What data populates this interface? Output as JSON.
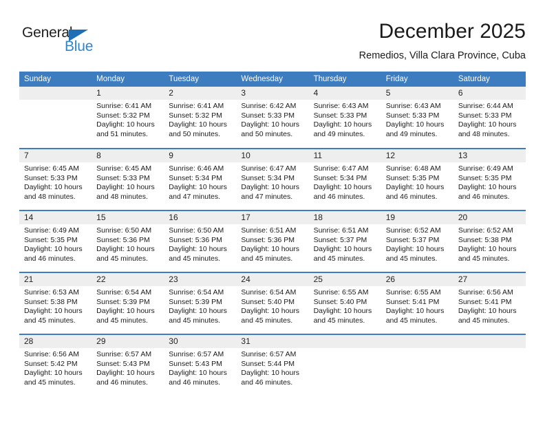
{
  "brand": {
    "name_part1": "General",
    "name_part2": "Blue",
    "triangle_color": "#1f6fb5",
    "blue_color": "#2f86cd"
  },
  "header": {
    "month_title": "December 2025",
    "location": "Remedios, Villa Clara Province, Cuba"
  },
  "theme": {
    "header_band": "#3d7cbf",
    "daynum_band": "#eeeeee",
    "divider": "#3d7cbf",
    "text": "#1a1a1a"
  },
  "weekdays": [
    "Sunday",
    "Monday",
    "Tuesday",
    "Wednesday",
    "Thursday",
    "Friday",
    "Saturday"
  ],
  "weeks": [
    [
      {
        "day": "",
        "sunrise": "",
        "sunset": "",
        "daylight": "",
        "daylight2": ""
      },
      {
        "day": "1",
        "sunrise": "Sunrise: 6:41 AM",
        "sunset": "Sunset: 5:32 PM",
        "daylight": "Daylight: 10 hours",
        "daylight2": "and 51 minutes."
      },
      {
        "day": "2",
        "sunrise": "Sunrise: 6:41 AM",
        "sunset": "Sunset: 5:32 PM",
        "daylight": "Daylight: 10 hours",
        "daylight2": "and 50 minutes."
      },
      {
        "day": "3",
        "sunrise": "Sunrise: 6:42 AM",
        "sunset": "Sunset: 5:33 PM",
        "daylight": "Daylight: 10 hours",
        "daylight2": "and 50 minutes."
      },
      {
        "day": "4",
        "sunrise": "Sunrise: 6:43 AM",
        "sunset": "Sunset: 5:33 PM",
        "daylight": "Daylight: 10 hours",
        "daylight2": "and 49 minutes."
      },
      {
        "day": "5",
        "sunrise": "Sunrise: 6:43 AM",
        "sunset": "Sunset: 5:33 PM",
        "daylight": "Daylight: 10 hours",
        "daylight2": "and 49 minutes."
      },
      {
        "day": "6",
        "sunrise": "Sunrise: 6:44 AM",
        "sunset": "Sunset: 5:33 PM",
        "daylight": "Daylight: 10 hours",
        "daylight2": "and 48 minutes."
      }
    ],
    [
      {
        "day": "7",
        "sunrise": "Sunrise: 6:45 AM",
        "sunset": "Sunset: 5:33 PM",
        "daylight": "Daylight: 10 hours",
        "daylight2": "and 48 minutes."
      },
      {
        "day": "8",
        "sunrise": "Sunrise: 6:45 AM",
        "sunset": "Sunset: 5:33 PM",
        "daylight": "Daylight: 10 hours",
        "daylight2": "and 48 minutes."
      },
      {
        "day": "9",
        "sunrise": "Sunrise: 6:46 AM",
        "sunset": "Sunset: 5:34 PM",
        "daylight": "Daylight: 10 hours",
        "daylight2": "and 47 minutes."
      },
      {
        "day": "10",
        "sunrise": "Sunrise: 6:47 AM",
        "sunset": "Sunset: 5:34 PM",
        "daylight": "Daylight: 10 hours",
        "daylight2": "and 47 minutes."
      },
      {
        "day": "11",
        "sunrise": "Sunrise: 6:47 AM",
        "sunset": "Sunset: 5:34 PM",
        "daylight": "Daylight: 10 hours",
        "daylight2": "and 46 minutes."
      },
      {
        "day": "12",
        "sunrise": "Sunrise: 6:48 AM",
        "sunset": "Sunset: 5:35 PM",
        "daylight": "Daylight: 10 hours",
        "daylight2": "and 46 minutes."
      },
      {
        "day": "13",
        "sunrise": "Sunrise: 6:49 AM",
        "sunset": "Sunset: 5:35 PM",
        "daylight": "Daylight: 10 hours",
        "daylight2": "and 46 minutes."
      }
    ],
    [
      {
        "day": "14",
        "sunrise": "Sunrise: 6:49 AM",
        "sunset": "Sunset: 5:35 PM",
        "daylight": "Daylight: 10 hours",
        "daylight2": "and 46 minutes."
      },
      {
        "day": "15",
        "sunrise": "Sunrise: 6:50 AM",
        "sunset": "Sunset: 5:36 PM",
        "daylight": "Daylight: 10 hours",
        "daylight2": "and 45 minutes."
      },
      {
        "day": "16",
        "sunrise": "Sunrise: 6:50 AM",
        "sunset": "Sunset: 5:36 PM",
        "daylight": "Daylight: 10 hours",
        "daylight2": "and 45 minutes."
      },
      {
        "day": "17",
        "sunrise": "Sunrise: 6:51 AM",
        "sunset": "Sunset: 5:36 PM",
        "daylight": "Daylight: 10 hours",
        "daylight2": "and 45 minutes."
      },
      {
        "day": "18",
        "sunrise": "Sunrise: 6:51 AM",
        "sunset": "Sunset: 5:37 PM",
        "daylight": "Daylight: 10 hours",
        "daylight2": "and 45 minutes."
      },
      {
        "day": "19",
        "sunrise": "Sunrise: 6:52 AM",
        "sunset": "Sunset: 5:37 PM",
        "daylight": "Daylight: 10 hours",
        "daylight2": "and 45 minutes."
      },
      {
        "day": "20",
        "sunrise": "Sunrise: 6:52 AM",
        "sunset": "Sunset: 5:38 PM",
        "daylight": "Daylight: 10 hours",
        "daylight2": "and 45 minutes."
      }
    ],
    [
      {
        "day": "21",
        "sunrise": "Sunrise: 6:53 AM",
        "sunset": "Sunset: 5:38 PM",
        "daylight": "Daylight: 10 hours",
        "daylight2": "and 45 minutes."
      },
      {
        "day": "22",
        "sunrise": "Sunrise: 6:54 AM",
        "sunset": "Sunset: 5:39 PM",
        "daylight": "Daylight: 10 hours",
        "daylight2": "and 45 minutes."
      },
      {
        "day": "23",
        "sunrise": "Sunrise: 6:54 AM",
        "sunset": "Sunset: 5:39 PM",
        "daylight": "Daylight: 10 hours",
        "daylight2": "and 45 minutes."
      },
      {
        "day": "24",
        "sunrise": "Sunrise: 6:54 AM",
        "sunset": "Sunset: 5:40 PM",
        "daylight": "Daylight: 10 hours",
        "daylight2": "and 45 minutes."
      },
      {
        "day": "25",
        "sunrise": "Sunrise: 6:55 AM",
        "sunset": "Sunset: 5:40 PM",
        "daylight": "Daylight: 10 hours",
        "daylight2": "and 45 minutes."
      },
      {
        "day": "26",
        "sunrise": "Sunrise: 6:55 AM",
        "sunset": "Sunset: 5:41 PM",
        "daylight": "Daylight: 10 hours",
        "daylight2": "and 45 minutes."
      },
      {
        "day": "27",
        "sunrise": "Sunrise: 6:56 AM",
        "sunset": "Sunset: 5:41 PM",
        "daylight": "Daylight: 10 hours",
        "daylight2": "and 45 minutes."
      }
    ],
    [
      {
        "day": "28",
        "sunrise": "Sunrise: 6:56 AM",
        "sunset": "Sunset: 5:42 PM",
        "daylight": "Daylight: 10 hours",
        "daylight2": "and 45 minutes."
      },
      {
        "day": "29",
        "sunrise": "Sunrise: 6:57 AM",
        "sunset": "Sunset: 5:43 PM",
        "daylight": "Daylight: 10 hours",
        "daylight2": "and 46 minutes."
      },
      {
        "day": "30",
        "sunrise": "Sunrise: 6:57 AM",
        "sunset": "Sunset: 5:43 PM",
        "daylight": "Daylight: 10 hours",
        "daylight2": "and 46 minutes."
      },
      {
        "day": "31",
        "sunrise": "Sunrise: 6:57 AM",
        "sunset": "Sunset: 5:44 PM",
        "daylight": "Daylight: 10 hours",
        "daylight2": "and 46 minutes."
      },
      {
        "day": "",
        "sunrise": "",
        "sunset": "",
        "daylight": "",
        "daylight2": ""
      },
      {
        "day": "",
        "sunrise": "",
        "sunset": "",
        "daylight": "",
        "daylight2": ""
      },
      {
        "day": "",
        "sunrise": "",
        "sunset": "",
        "daylight": "",
        "daylight2": ""
      }
    ]
  ]
}
